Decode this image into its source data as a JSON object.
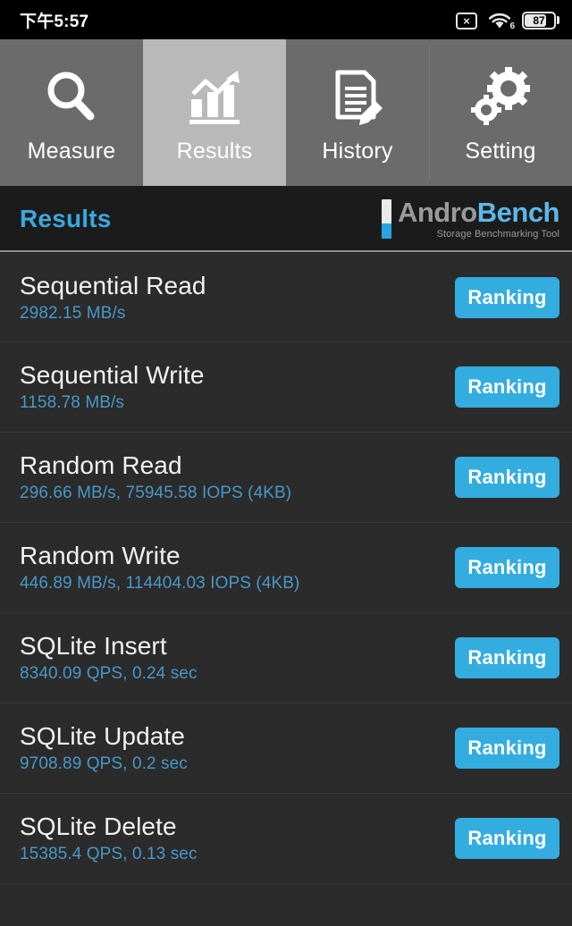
{
  "statusbar": {
    "time": "下午5:57",
    "icons": {
      "close_box": "×",
      "wifi_gen": "6",
      "battery_level": "87"
    }
  },
  "tabs": [
    {
      "label": "Measure",
      "icon": "magnifier-icon",
      "active": false
    },
    {
      "label": "Results",
      "icon": "bar-chart-icon",
      "active": true
    },
    {
      "label": "History",
      "icon": "document-pencil-icon",
      "active": false
    },
    {
      "label": "Setting",
      "icon": "gears-icon",
      "active": false
    }
  ],
  "header": {
    "title": "Results",
    "logo_primary": "Andro",
    "logo_secondary": "Bench",
    "logo_tagline": "Storage Benchmarking Tool"
  },
  "results": [
    {
      "name": "Sequential Read",
      "value": "2982.15 MB/s",
      "action": "Ranking"
    },
    {
      "name": "Sequential Write",
      "value": "1158.78 MB/s",
      "action": "Ranking"
    },
    {
      "name": "Random Read",
      "value": "296.66 MB/s, 75945.58 IOPS (4KB)",
      "action": "Ranking"
    },
    {
      "name": "Random Write",
      "value": "446.89 MB/s, 114404.03 IOPS (4KB)",
      "action": "Ranking"
    },
    {
      "name": "SQLite Insert",
      "value": "8340.09 QPS, 0.24 sec",
      "action": "Ranking"
    },
    {
      "name": "SQLite Update",
      "value": "9708.89 QPS, 0.2 sec",
      "action": "Ranking"
    },
    {
      "name": "SQLite Delete",
      "value": "15385.4 QPS, 0.13 sec",
      "action": "Ranking"
    }
  ],
  "colors": {
    "accent_blue": "#33ade0",
    "title_blue": "#3ba8e0",
    "value_blue": "#4898c8",
    "tab_inactive": "#6b6b6b",
    "tab_active": "#b9b9b9",
    "list_bg": "#2b2b2b",
    "header_bg": "#1b1b1b"
  }
}
